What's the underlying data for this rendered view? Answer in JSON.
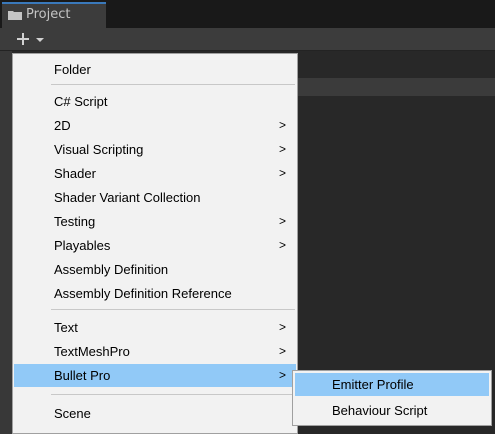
{
  "window": {
    "tab_label": "Project",
    "folder_icon": "folder-icon",
    "add_icon": "plus-icon"
  },
  "menu": {
    "items": [
      {
        "label": "Folder",
        "submenu": false
      },
      {
        "label": "C# Script",
        "submenu": false
      },
      {
        "label": "2D",
        "submenu": true
      },
      {
        "label": "Visual Scripting",
        "submenu": true
      },
      {
        "label": "Shader",
        "submenu": true
      },
      {
        "label": "Shader Variant Collection",
        "submenu": false
      },
      {
        "label": "Testing",
        "submenu": true
      },
      {
        "label": "Playables",
        "submenu": true
      },
      {
        "label": "Assembly Definition",
        "submenu": false
      },
      {
        "label": "Assembly Definition Reference",
        "submenu": false
      },
      {
        "label": "Text",
        "submenu": true
      },
      {
        "label": "TextMeshPro",
        "submenu": true
      },
      {
        "label": "Bullet Pro",
        "submenu": true,
        "highlighted": true
      },
      {
        "label": "Scene",
        "submenu": false
      }
    ],
    "arrow_glyph": ">"
  },
  "submenu": {
    "items": [
      {
        "label": "Emitter Profile",
        "highlighted": true
      },
      {
        "label": "Behaviour Script"
      }
    ]
  },
  "colors": {
    "highlight": "#91c9f7",
    "menu_bg": "#f2f2f2",
    "editor_bg": "#282828"
  }
}
